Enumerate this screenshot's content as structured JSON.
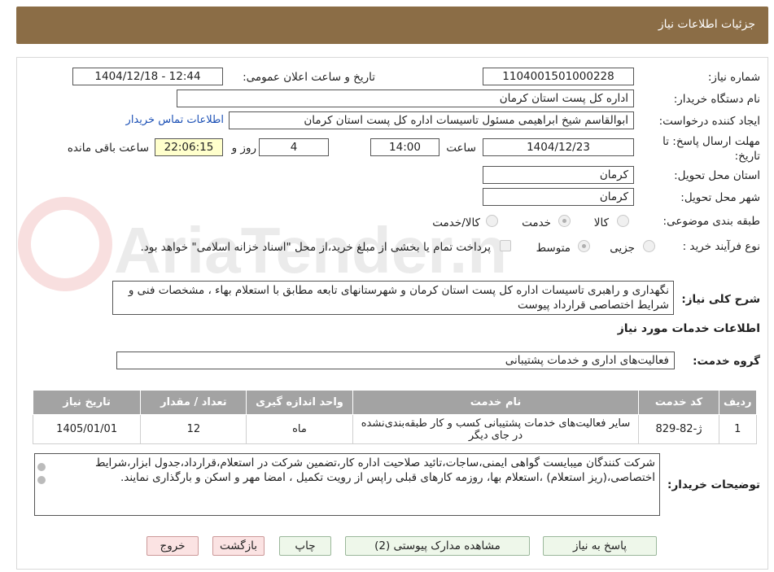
{
  "header": {
    "title": "جزئیات اطلاعات نیاز"
  },
  "fields": {
    "need_number_label": "شماره نیاز:",
    "need_number": "1104001501000228",
    "announce_label": "تاریخ و ساعت اعلان عمومی:",
    "announce_value": "1404/12/18 - 12:44",
    "buyer_org_label": "نام دستگاه خریدار:",
    "buyer_org": "اداره کل پست استان کرمان",
    "creator_label": "ایجاد کننده درخواست:",
    "creator": "ابوالقاسم شیخ ابراهیمی مسئول تاسیسات اداره کل پست استان کرمان",
    "contact_link": "اطلاعات تماس خریدار",
    "deadline_label_1": "مهلت ارسال پاسخ: تا",
    "deadline_label_2": "تاریخ:",
    "deadline_date": "1404/12/23",
    "time_label": "ساعت",
    "deadline_time": "14:00",
    "days_value": "4",
    "days_label": "روز و",
    "remaining_time": "22:06:15",
    "remaining_label": "ساعت باقی مانده",
    "province_label": "استان محل تحویل:",
    "province": "کرمان",
    "city_label": "شهر محل تحویل:",
    "city": "کرمان",
    "category_label": "طبقه بندی موضوعی:",
    "category_options": [
      "کالا",
      "خدمت",
      "کالا/خدمت"
    ],
    "process_label": "نوع فرآیند خرید :",
    "process_options": [
      "جزیی",
      "متوسط"
    ],
    "payment_note": "پرداخت تمام یا بخشی از مبلغ خرید،از محل \"اسناد خزانه اسلامی\" خواهد بود."
  },
  "description": {
    "label": "شرح کلی نیاز:",
    "text": "نگهداری و راهبری تاسیسات اداره کل پست استان کرمان و شهرستانهای تابعه مطابق با استعلام بهاء ، مشخصات فنی و شرایط اختصاصی قرارداد پیوست"
  },
  "services_section": {
    "title": "اطلاعات خدمات مورد نیاز",
    "group_label": "گروه خدمت:",
    "group_value": "فعالیت‌های اداری و خدمات پشتیبانی"
  },
  "table": {
    "headers": [
      "ردیف",
      "کد خدمت",
      "نام خدمت",
      "واحد اندازه گیری",
      "تعداد / مقدار",
      "تاریخ نیاز"
    ],
    "rows": [
      [
        "1",
        "ژ-82-829",
        "سایر فعالیت‌های خدمات پشتیبانی کسب و کار طبقه‌بندی‌نشده در جای دیگر",
        "ماه",
        "12",
        "1405/01/01"
      ]
    ]
  },
  "buyer_notes": {
    "label": "توضیحات خریدار:",
    "text": "شرکت کنندگان میبایست گواهی ایمنی،ساجات،تائید صلاحیت اداره کار،تضمین شرکت در استعلام،قرارداد،جدول ابزار،شرایط اختصاصی،(ریز استعلام) ،استعلام بها، روزمه کارهای قبلی راپس از رویت تکمیل ، امضا مهر و اسکن و بارگذاری نمایند."
  },
  "buttons": {
    "reply": "پاسخ به نیاز",
    "attachments": "مشاهده مدارک پیوستی (2)",
    "print": "چاپ",
    "back": "بازگشت",
    "exit": "خروج"
  },
  "watermark": "AriaTender.neT",
  "colors": {
    "header_bg": "#8b6d46",
    "link": "#1a4fb5",
    "table_header": "#a3a3a3"
  }
}
